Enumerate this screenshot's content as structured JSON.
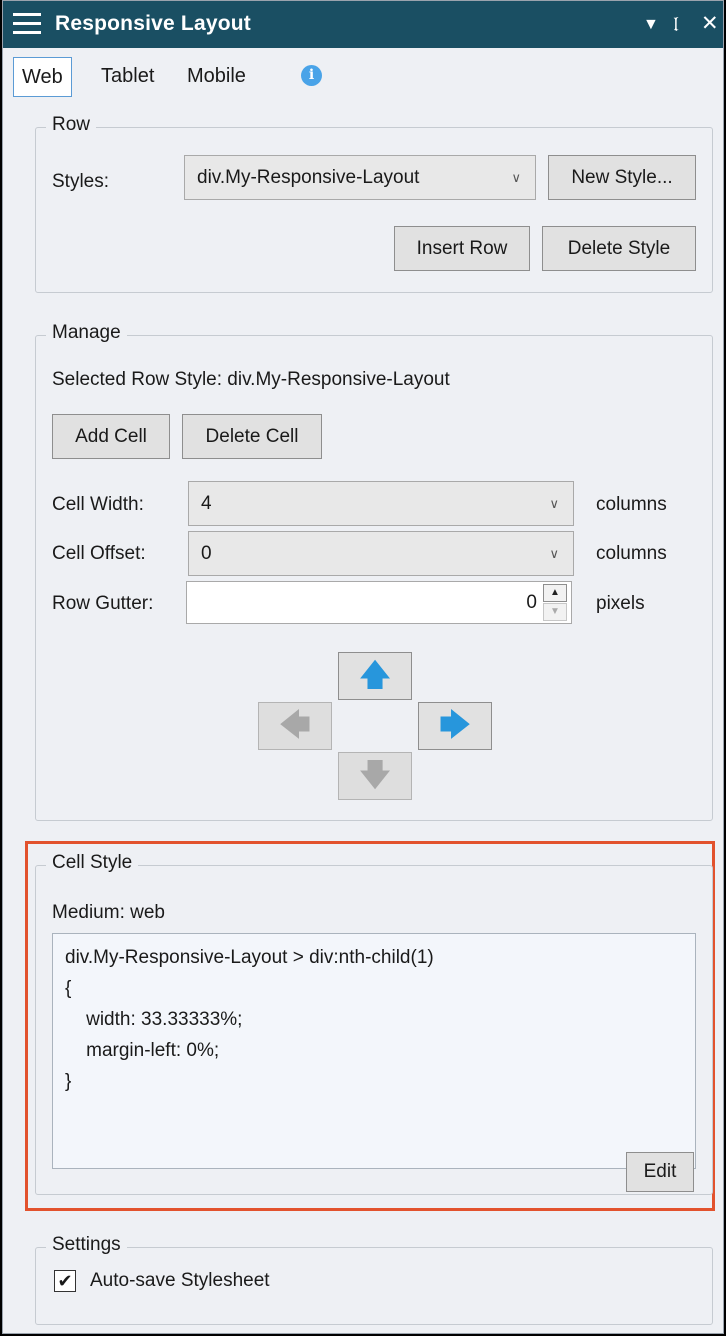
{
  "titlebar": {
    "title": "Responsive Layout",
    "icons": [
      "menu-icon",
      "dropdown-icon",
      "pin-icon",
      "close-icon"
    ],
    "bg_color": "#1a4f63"
  },
  "tabs": [
    {
      "label": "Web",
      "active": true
    },
    {
      "label": "Tablet",
      "active": false
    },
    {
      "label": "Mobile",
      "active": false
    }
  ],
  "row": {
    "legend": "Row",
    "styles_label": "Styles:",
    "styles_value": "div.My-Responsive-Layout",
    "new_style": "New Style...",
    "insert_row": "Insert Row",
    "delete_style": "Delete Style"
  },
  "manage": {
    "legend": "Manage",
    "selected": "Selected Row Style: div.My-Responsive-Layout",
    "add_cell": "Add Cell",
    "delete_cell": "Delete Cell",
    "cell_width_label": "Cell Width:",
    "cell_width_value": "4",
    "cell_width_unit": "columns",
    "cell_offset_label": "Cell Offset:",
    "cell_offset_value": "0",
    "cell_offset_unit": "columns",
    "row_gutter_label": "Row Gutter:",
    "row_gutter_value": "0",
    "row_gutter_unit": "pixels",
    "arrow_colors": {
      "enabled": "#2796dc",
      "disabled": "#a8a8a8"
    }
  },
  "cell_style": {
    "legend": "Cell Style",
    "medium": "Medium: web",
    "code_lines": [
      "div.My-Responsive-Layout > div:nth-child(1)",
      "{",
      "    width: 33.33333%;",
      "    margin-left: 0%;",
      "}"
    ],
    "edit": "Edit",
    "highlight_color": "#e2522d"
  },
  "settings": {
    "legend": "Settings",
    "autosave_label": "Auto-save Stylesheet",
    "autosave_checked": true
  }
}
